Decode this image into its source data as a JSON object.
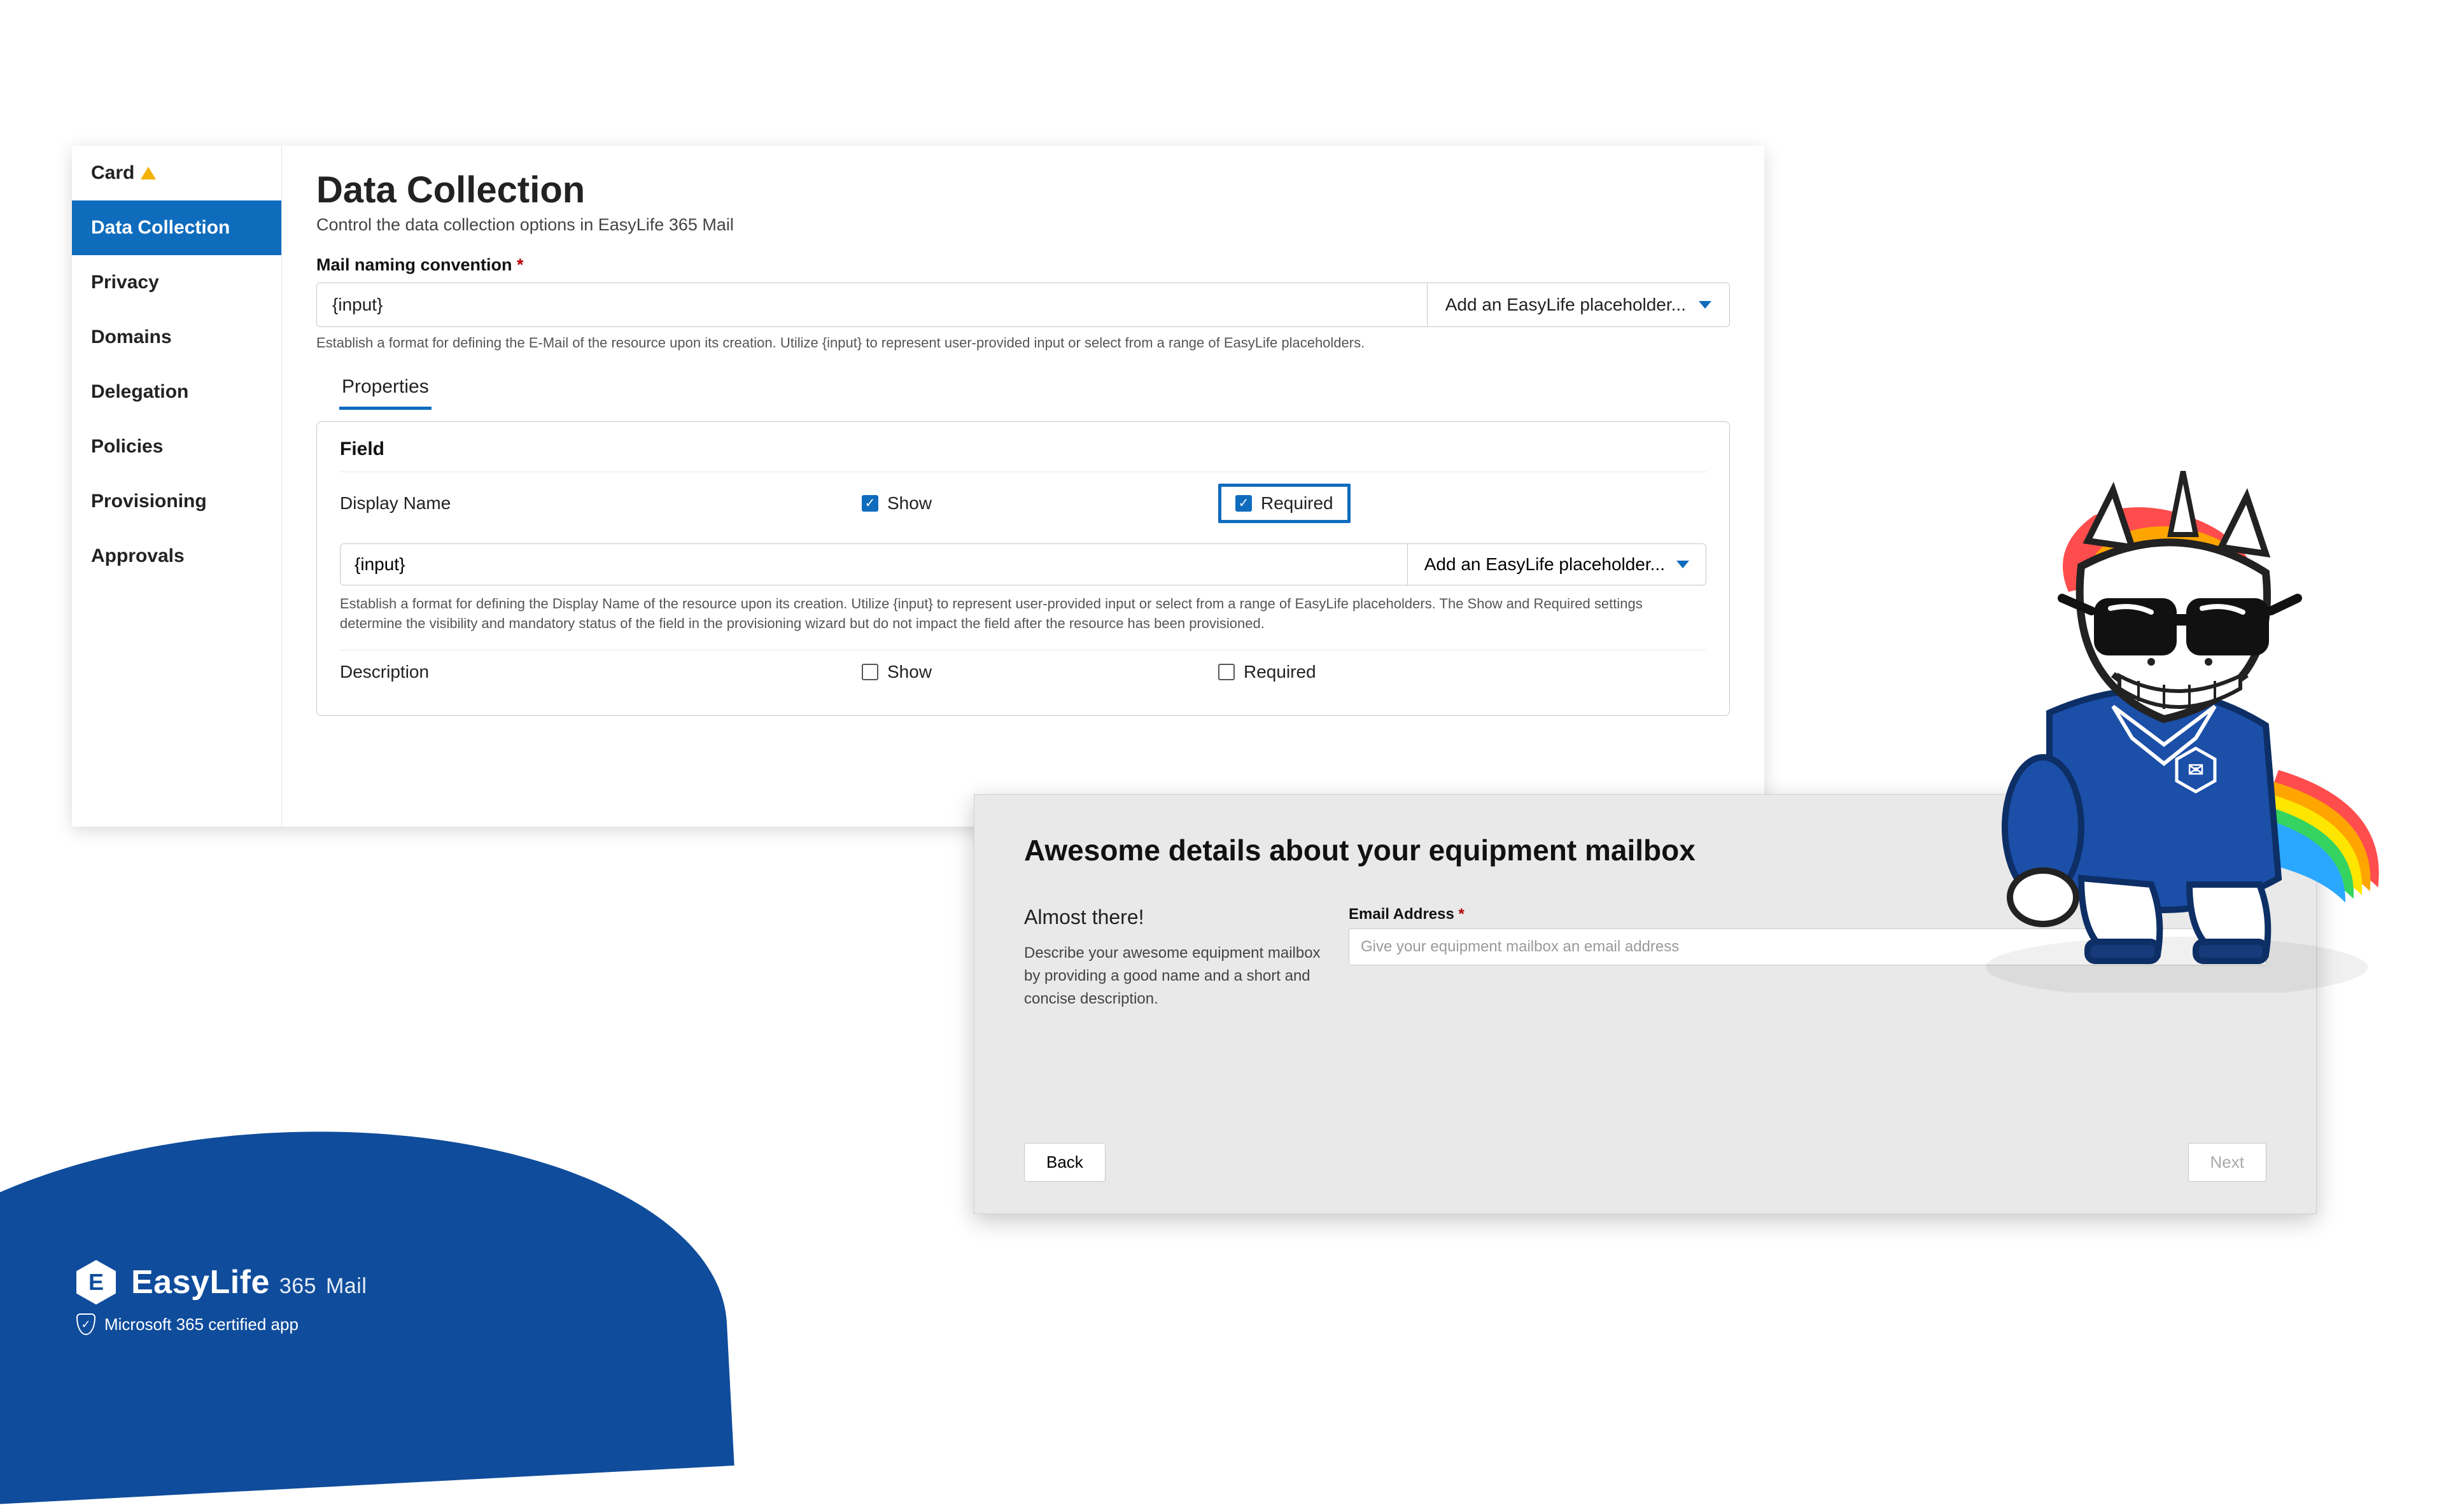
{
  "sidebar": {
    "items": [
      {
        "label": "Card",
        "warn": true
      },
      {
        "label": "Data Collection",
        "active": true
      },
      {
        "label": "Privacy"
      },
      {
        "label": "Domains"
      },
      {
        "label": "Delegation"
      },
      {
        "label": "Policies"
      },
      {
        "label": "Provisioning"
      },
      {
        "label": "Approvals"
      }
    ]
  },
  "main": {
    "title": "Data Collection",
    "subtitle": "Control the data collection options in EasyLife 365 Mail",
    "mail_naming": {
      "label": "Mail naming convention",
      "required_marker": "*",
      "value": "{input}",
      "placeholder_dd": "Add an EasyLife placeholder...",
      "hint": "Establish a format for defining the E-Mail of the resource upon its creation. Utilize {input} to represent user-provided input or select from a range of EasyLife placeholders."
    },
    "tabs": {
      "properties": "Properties"
    },
    "props": {
      "header": "Field",
      "display_name": {
        "label": "Display Name",
        "show_label": "Show",
        "show_checked": true,
        "required_label": "Required",
        "required_checked": true,
        "value": "{input}",
        "dd": "Add an EasyLife placeholder...",
        "hint": "Establish a format for defining the Display Name of the resource upon its creation. Utilize {input} to represent user-provided input or select from a range of EasyLife placeholders. The Show and Required settings determine the visibility and mandatory status of the field in the provisioning wizard but do not impact the field after the resource has been provisioned."
      },
      "description": {
        "label": "Description",
        "show_label": "Show",
        "show_checked": false,
        "required_label": "Required",
        "required_checked": false
      }
    }
  },
  "wizard": {
    "title": "Awesome details about your equipment mailbox",
    "left_heading": "Almost there!",
    "left_body": "Describe your awesome equipment mailbox by providing a good name and a short and concise description.",
    "email_label": "Email Address",
    "required_marker": "*",
    "email_placeholder": "Give your equipment mailbox an email address",
    "back": "Back",
    "next": "Next"
  },
  "brand": {
    "logo_letter": "E",
    "name_bold": "EasyLife",
    "name_365": "365",
    "name_tail": "Mail",
    "cert": "Microsoft 365 certified app",
    "shield_check": "✓"
  }
}
